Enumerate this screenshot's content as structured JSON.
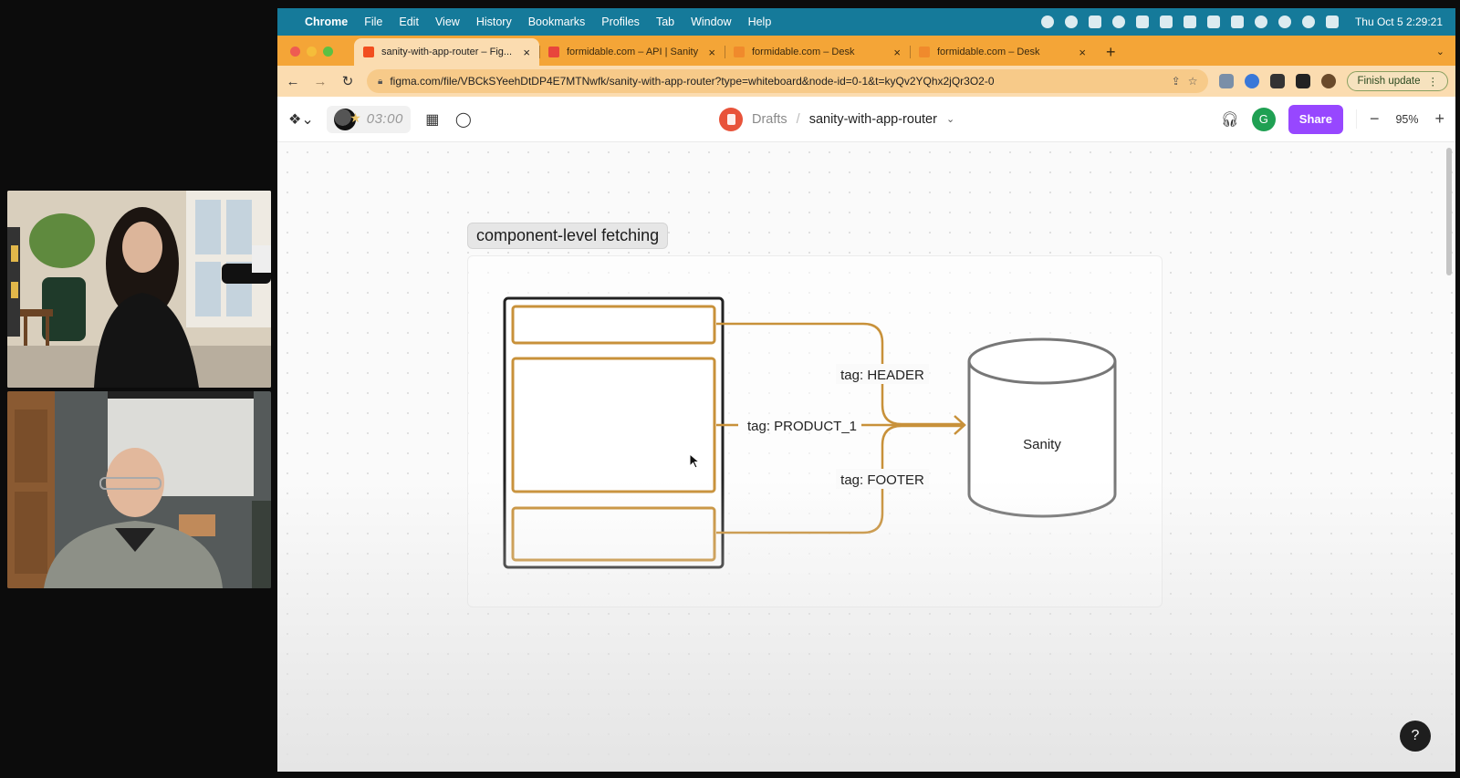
{
  "menubar": {
    "app": "Chrome",
    "items": [
      "File",
      "Edit",
      "View",
      "History",
      "Bookmarks",
      "Profiles",
      "Tab",
      "Window",
      "Help"
    ],
    "clock": "Thu Oct 5  2:29:21"
  },
  "tabs": [
    {
      "label": "sanity-with-app-router – Fig...",
      "favicon": "figma-icon",
      "color": "#f24e1e"
    },
    {
      "label": "formidable.com – API | Sanity",
      "favicon": "sanity-icon",
      "color": "#e8453c"
    },
    {
      "label": "formidable.com – Desk",
      "favicon": "sanity-desk-icon",
      "color": "#f08a2c"
    },
    {
      "label": "formidable.com – Desk",
      "favicon": "sanity-desk-icon",
      "color": "#f08a2c"
    }
  ],
  "address": {
    "url": "figma.com/file/VBCkSYeehDtDP4E7MTNwfk/sanity-with-app-router?type=whiteboard&node-id=0-1&t=kyQv2YQhx2jQr3O2-0",
    "finish_update": "Finish update"
  },
  "figma": {
    "timer": "03:00",
    "breadcrumb_parent": "Drafts",
    "breadcrumb_sep": "/",
    "file_name": "sanity-with-app-router",
    "avatar_initial": "G",
    "share_label": "Share",
    "zoom": "95%"
  },
  "diagram": {
    "section_title": "component-level fetching",
    "tags": {
      "header": "tag: HEADER",
      "product": "tag: PRODUCT_1",
      "footer": "tag: FOOTER"
    },
    "database_label": "Sanity",
    "stroke_color": "#c8913a"
  },
  "help_label": "?"
}
